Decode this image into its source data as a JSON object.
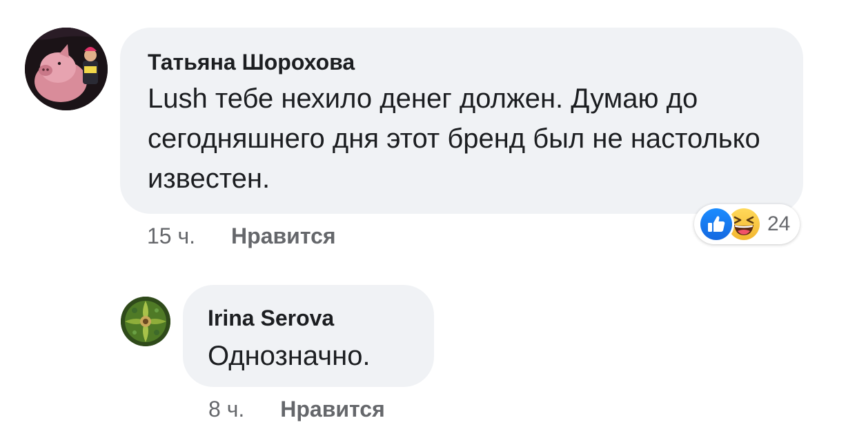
{
  "comments": [
    {
      "author": "Татьяна Шорохова",
      "text": "Lush тебе нехило денег должен. Думаю до сегодняшнего дня этот бренд был не настолько известен.",
      "time": "15 ч.",
      "like_label": "Нравится",
      "avatar_icon": "pig-avatar",
      "reactions": {
        "icons": [
          "like-icon",
          "haha-icon"
        ],
        "count": "24"
      }
    },
    {
      "author": "Irina Serova",
      "text": "Однозначно.",
      "time": "8 ч.",
      "like_label": "Нравится",
      "avatar_icon": "green-ornament-avatar"
    }
  ],
  "colors": {
    "bubble": "#f0f2f5",
    "meta_text": "#65676b",
    "like_blue": "#1877f2",
    "haha_yellow": "#f7c948"
  }
}
